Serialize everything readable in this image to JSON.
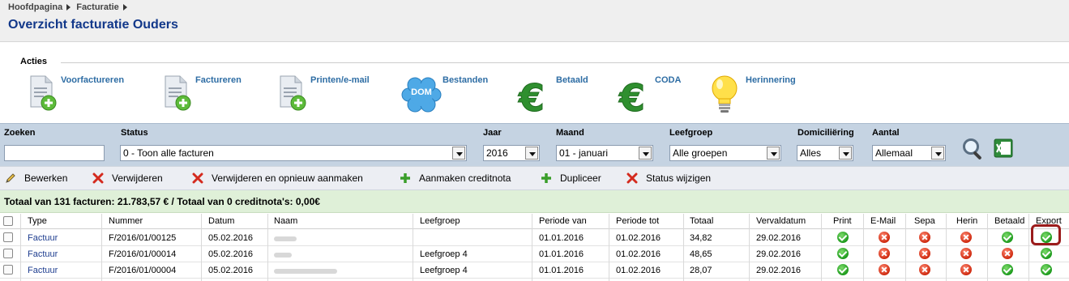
{
  "breadcrumb": [
    "Hoofdpagina",
    "Facturatie"
  ],
  "page_title": "Overzicht facturatie Ouders",
  "actions": {
    "title": "Acties",
    "items": [
      {
        "label": "Voorfactureren",
        "icon": "document-add-icon"
      },
      {
        "label": "Factureren",
        "icon": "document-add-icon"
      },
      {
        "label": "Printen/e-mail",
        "icon": "document-add-icon"
      },
      {
        "label": "Bestanden",
        "icon": "dom-cloud-icon",
        "badge": "DOM"
      },
      {
        "label": "Betaald",
        "icon": "euro-icon"
      },
      {
        "label": "CODA",
        "icon": "euro-icon"
      },
      {
        "label": "Herinnering",
        "icon": "lightbulb-icon"
      }
    ]
  },
  "filters": {
    "zoeken": {
      "label": "Zoeken",
      "value": ""
    },
    "status": {
      "label": "Status",
      "value": "0 - Toon alle facturen"
    },
    "jaar": {
      "label": "Jaar",
      "value": "2016"
    },
    "maand": {
      "label": "Maand",
      "value": "01 - januari"
    },
    "leefgroep": {
      "label": "Leefgroep",
      "value": "Alle groepen"
    },
    "domiciliering": {
      "label": "Domiciliëring",
      "value": "Alles"
    },
    "aantal": {
      "label": "Aantal",
      "value": "Allemaal"
    }
  },
  "toolbar": [
    {
      "label": "Bewerken",
      "icon": "pencil-icon"
    },
    {
      "label": "Verwijderen",
      "icon": "delete-icon"
    },
    {
      "label": "Verwijderen en opnieuw aanmaken",
      "icon": "delete-icon"
    },
    {
      "label": "Aanmaken creditnota",
      "icon": "plus-icon"
    },
    {
      "label": "Dupliceer",
      "icon": "plus-icon"
    },
    {
      "label": "Status wijzigen",
      "icon": "delete-icon"
    }
  ],
  "totals": "Totaal van 131 facturen:  21.783,57 € / Totaal van 0 creditnota's:  0,00€",
  "table": {
    "columns": [
      "Type",
      "Nummer",
      "Datum",
      "Naam",
      "Leefgroep",
      "Periode van",
      "Periode tot",
      "Totaal",
      "Vervaldatum",
      "Print",
      "E-Mail",
      "Sepa",
      "Herin",
      "Betaald",
      "Export"
    ],
    "rows": [
      {
        "type": "Factuur",
        "nummer": "F/2016/01/00125",
        "datum": "05.02.2016",
        "leefgroep": "",
        "van": "01.01.2016",
        "tot": "01.02.2016",
        "totaal": "34,82",
        "verval": "29.02.2016",
        "status": [
          "ok",
          "no",
          "no",
          "no",
          "ok",
          "ok"
        ]
      },
      {
        "type": "Factuur",
        "nummer": "F/2016/01/00014",
        "datum": "05.02.2016",
        "leefgroep": "Leefgroep 4",
        "van": "01.01.2016",
        "tot": "01.02.2016",
        "totaal": "48,65",
        "verval": "29.02.2016",
        "status": [
          "ok",
          "no",
          "no",
          "no",
          "no",
          "ok"
        ]
      },
      {
        "type": "Factuur",
        "nummer": "F/2016/01/00004",
        "datum": "05.02.2016",
        "leefgroep": "Leefgroep 4",
        "van": "01.01.2016",
        "tot": "01.02.2016",
        "totaal": "28,07",
        "verval": "29.02.2016",
        "status": [
          "ok",
          "no",
          "no",
          "no",
          "ok",
          "ok"
        ]
      }
    ]
  },
  "colors": {
    "title": "#12388a",
    "link": "#2e6da4",
    "ok": "#1c9a1c",
    "error": "#cf2a10",
    "highlight": "#9b1c1c"
  }
}
